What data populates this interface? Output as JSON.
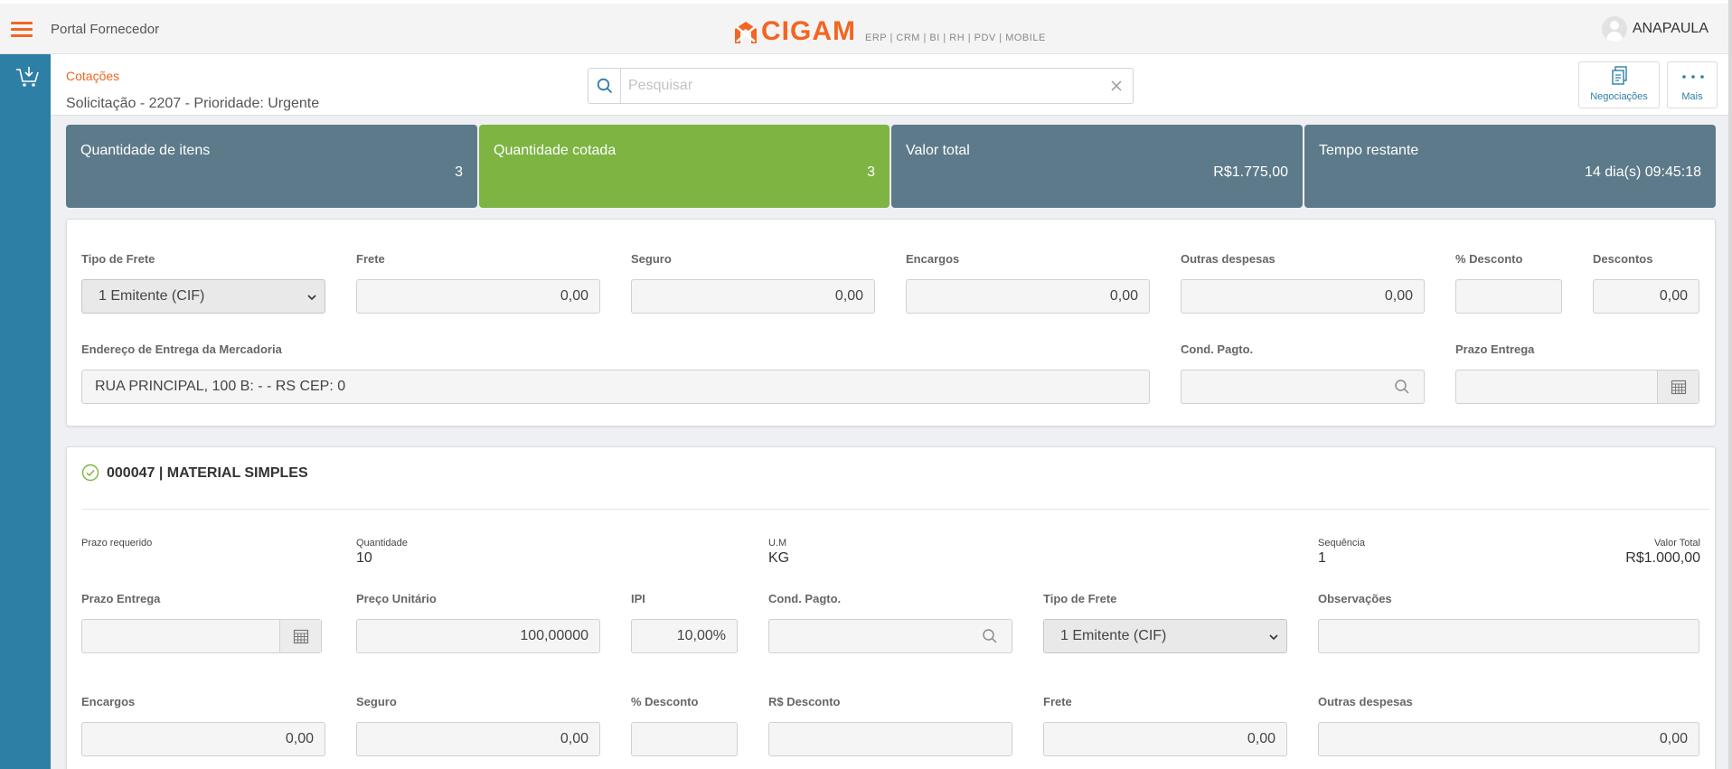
{
  "header": {
    "portal_title": "Portal Fornecedor",
    "logo_text": "CIGAM",
    "logo_tagline": "ERP | CRM | BI | RH | PDV | MOBILE",
    "user_name": "ANAPAULA",
    "brand_color": "#f26522",
    "sidebar_color": "#2d7fa6"
  },
  "subheader": {
    "breadcrumb": "Cotações",
    "subtitle": "Solicitação - 2207 - Prioridade: Urgente",
    "search_placeholder": "Pesquisar",
    "search_value": "",
    "negociacoes_label": "Negociações",
    "mais_label": "Mais"
  },
  "stats": [
    {
      "title": "Quantidade de itens",
      "value": "3"
    },
    {
      "title": "Quantidade cotada",
      "value": "3"
    },
    {
      "title": "Valor total",
      "value": "R$1.775,00"
    },
    {
      "title": "Tempo restante",
      "value": "14 dia(s) 09:45:18"
    }
  ],
  "freight_panel": {
    "labels": {
      "tipo_frete": "Tipo de Frete",
      "frete": "Frete",
      "seguro": "Seguro",
      "encargos": "Encargos",
      "outras_despesas": "Outras despesas",
      "pct_desconto": "% Desconto",
      "descontos": "Descontos",
      "endereco": "Endereço de Entrega da Mercadoria",
      "cond_pagto": "Cond. Pagto.",
      "prazo_entrega": "Prazo Entrega"
    },
    "values": {
      "tipo_frete": "1 Emitente (CIF)",
      "frete": "0,00",
      "seguro": "0,00",
      "encargos": "0,00",
      "outras_despesas": "0,00",
      "pct_desconto": "",
      "descontos": "0,00",
      "endereco": "RUA PRINCIPAL, 100 B:  -  - RS CEP: 0",
      "cond_pagto": "",
      "prazo_entrega": ""
    }
  },
  "item": {
    "title": "000047 | MATERIAL SIMPLES",
    "info": {
      "prazo_requerido_label": "Prazo requerido",
      "prazo_requerido_value": "",
      "quantidade_label": "Quantidade",
      "quantidade_value": "10",
      "um_label": "U.M",
      "um_value": "KG",
      "sequencia_label": "Sequência",
      "sequencia_value": "1",
      "valor_total_label": "Valor Total",
      "valor_total_value": "R$1.000,00"
    },
    "labels": {
      "prazo_entrega": "Prazo Entrega",
      "preco_unitario": "Preço Unitário",
      "ipi": "IPI",
      "cond_pagto": "Cond. Pagto.",
      "tipo_frete": "Tipo de Frete",
      "observacoes": "Observações",
      "encargos": "Encargos",
      "seguro": "Seguro",
      "pct_desconto": "% Desconto",
      "rs_desconto": "R$ Desconto",
      "frete": "Frete",
      "outras_despesas": "Outras despesas"
    },
    "values": {
      "prazo_entrega": "",
      "preco_unitario": "100,00000",
      "ipi": "10,00%",
      "cond_pagto": "",
      "tipo_frete": "1 Emitente (CIF)",
      "observacoes": "",
      "encargos": "0,00",
      "seguro": "0,00",
      "pct_desconto": "",
      "rs_desconto": "",
      "frete": "0,00",
      "outras_despesas": "0,00"
    }
  }
}
